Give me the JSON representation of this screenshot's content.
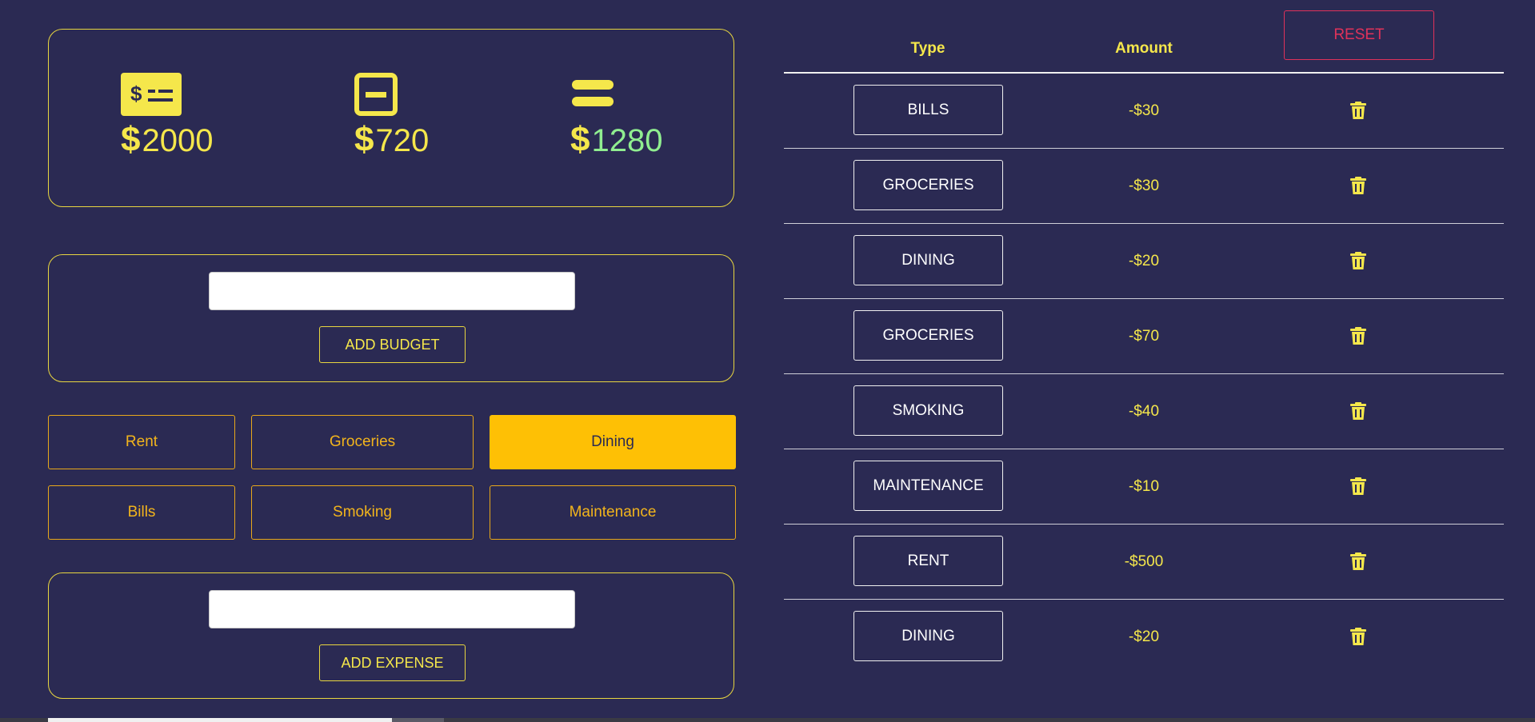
{
  "summary": {
    "budget": {
      "icon": "money-check-icon",
      "currency": "$",
      "value": "2000"
    },
    "expenses": {
      "icon": "minus-square-icon",
      "currency": "$",
      "value": "720"
    },
    "balance": {
      "icon": "equals-icon",
      "currency": "$",
      "value": "1280"
    }
  },
  "budget_form": {
    "input_value": "",
    "button_label": "ADD BUDGET"
  },
  "categories": [
    {
      "label": "Rent",
      "active": false
    },
    {
      "label": "Groceries",
      "active": false
    },
    {
      "label": "Dining",
      "active": true
    },
    {
      "label": "Bills",
      "active": false
    },
    {
      "label": "Smoking",
      "active": false
    },
    {
      "label": "Maintenance",
      "active": false
    }
  ],
  "expense_form": {
    "input_value": "",
    "button_label": "ADD EXPENSE"
  },
  "table": {
    "headers": {
      "type": "Type",
      "amount": "Amount"
    },
    "reset_label": "RESET",
    "rows": [
      {
        "type": "BILLS",
        "amount": "-$30"
      },
      {
        "type": "GROCERIES",
        "amount": "-$30"
      },
      {
        "type": "DINING",
        "amount": "-$20"
      },
      {
        "type": "GROCERIES",
        "amount": "-$70"
      },
      {
        "type": "SMOKING",
        "amount": "-$40"
      },
      {
        "type": "MAINTENANCE",
        "amount": "-$10"
      },
      {
        "type": "RENT",
        "amount": "-$500"
      },
      {
        "type": "DINING",
        "amount": "-$20"
      }
    ]
  },
  "colors": {
    "background": "#2b2a53",
    "accent": "#f5e74b",
    "active_category": "#fec005",
    "positive": "#90ee90",
    "reset": "#e0325a"
  }
}
